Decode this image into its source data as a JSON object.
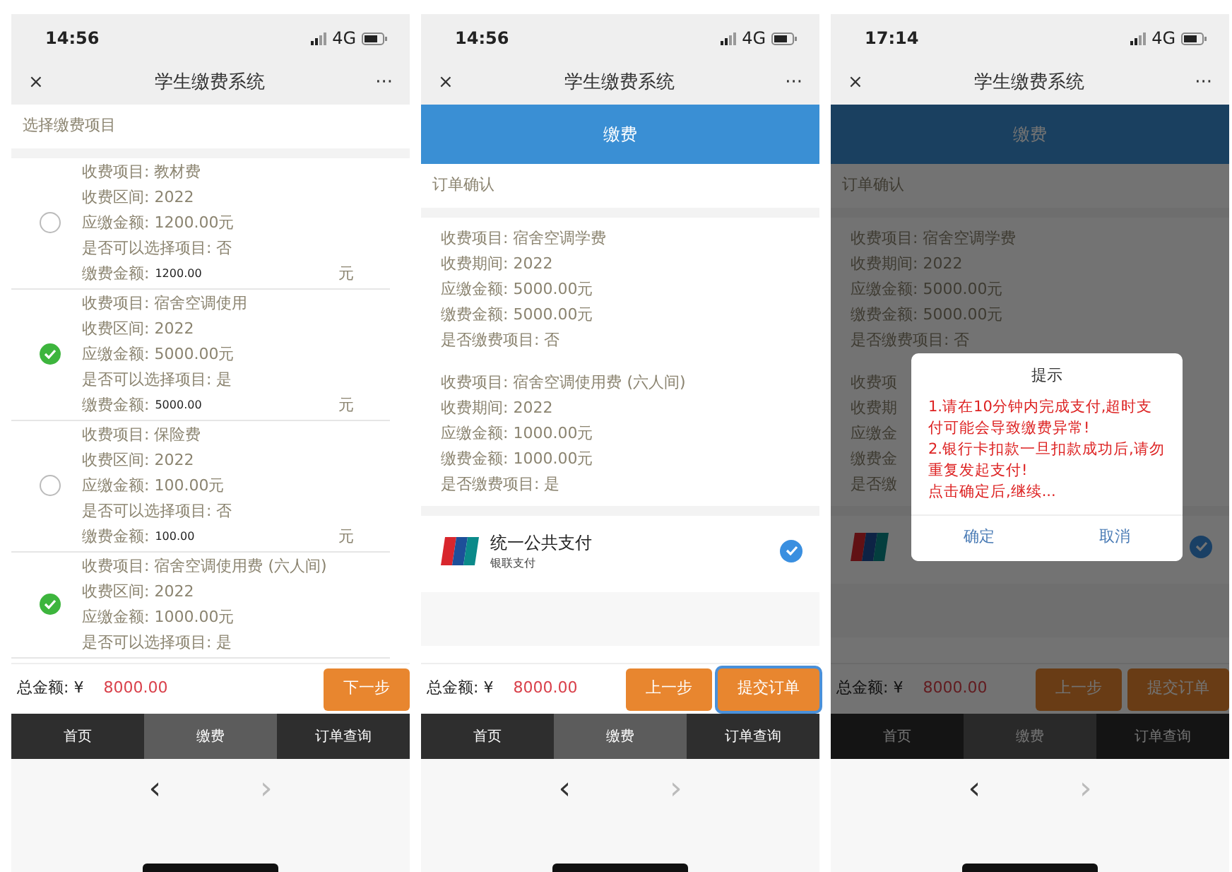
{
  "screens": [
    {
      "status": {
        "time": "14:56",
        "network": "4G"
      },
      "nav": {
        "close": "×",
        "title": "学生缴费系统",
        "more": "···"
      },
      "section_title": "选择缴费项目",
      "fee_items": [
        {
          "selected": false,
          "lines": [
            "收费项目: 教材费",
            "收费区间: 2022",
            "应缴金额: 1200.00元",
            "是否可以选择项目: 否"
          ],
          "amount": {
            "label": "缴费金额:",
            "value": "1200.00",
            "unit": "元"
          }
        },
        {
          "selected": true,
          "lines": [
            "收费项目: 宿舍空调使用",
            "收费区间: 2022",
            "应缴金额: 5000.00元",
            "是否可以选择项目: 是"
          ],
          "amount": {
            "label": "缴费金额:",
            "value": "5000.00",
            "unit": "元"
          }
        },
        {
          "selected": false,
          "lines": [
            "收费项目: 保险费",
            "收费区间: 2022",
            "应缴金额: 100.00元",
            "是否可以选择项目: 否"
          ],
          "amount": {
            "label": "缴费金额:",
            "value": "100.00",
            "unit": "元"
          }
        },
        {
          "selected": true,
          "lines": [
            "收费项目: 宿舍空调使用费 (六人间)",
            "收费区间: 2022",
            "应缴金额: 1000.00元",
            "是否可以选择项目: 是"
          ]
        }
      ],
      "total": {
        "label": "总金额: ¥",
        "value": "8000.00"
      },
      "buttons": [
        {
          "label": "下一步",
          "focused": false
        }
      ],
      "tabs": [
        {
          "label": "首页",
          "selected": false
        },
        {
          "label": "缴费",
          "selected": true
        },
        {
          "label": "订单查询",
          "selected": false
        }
      ],
      "browser": {
        "back": "‹",
        "forward": "›",
        "forward_disabled": true
      }
    },
    {
      "status": {
        "time": "14:56",
        "network": "4G"
      },
      "nav": {
        "close": "×",
        "title": "学生缴费系统",
        "more": "···"
      },
      "header": "缴费",
      "section_title": "订单确认",
      "order_items": [
        {
          "lines": [
            "收费项目: 宿舍空调学费",
            "收费期间: 2022",
            "应缴金额: 5000.00元",
            "缴费金额: 5000.00元",
            "是否缴费项目: 否"
          ]
        },
        {
          "lines": [
            "收费项目: 宿舍空调使用费 (六人间)",
            "收费期间: 2022",
            "应缴金额: 1000.00元",
            "缴费金额: 1000.00元",
            "是否缴费项目: 是"
          ]
        }
      ],
      "payment": {
        "title": "统一公共支付",
        "subtitle": "银联支付",
        "selected": true
      },
      "total": {
        "label": "总金额: ¥",
        "value": "8000.00"
      },
      "buttons": [
        {
          "label": "上一步",
          "focused": false
        },
        {
          "label": "提交订单",
          "focused": true
        }
      ],
      "tabs": [
        {
          "label": "首页",
          "selected": false
        },
        {
          "label": "缴费",
          "selected": true
        },
        {
          "label": "订单查询",
          "selected": false
        }
      ],
      "browser": {
        "back": "‹",
        "forward": "›",
        "forward_disabled": true
      }
    },
    {
      "status": {
        "time": "17:14",
        "network": "4G"
      },
      "nav": {
        "close": "×",
        "title": "学生缴费系统",
        "more": "···"
      },
      "header": "缴费",
      "section_title": "订单确认",
      "order_items": [
        {
          "lines": [
            "收费项目: 宿舍空调学费",
            "收费期间: 2022",
            "应缴金额: 5000.00元",
            "缴费金额: 5000.00元",
            "是否缴费项目: 否"
          ]
        },
        {
          "lines": [
            "收费项",
            "收费期",
            "应缴金",
            "缴费金",
            "是否缴"
          ]
        }
      ],
      "payment": {
        "selected": true
      },
      "total": {
        "label": "总金额: ¥",
        "value": "8000.00"
      },
      "buttons": [
        {
          "label": "上一步",
          "focused": false
        },
        {
          "label": "提交订单",
          "focused": false
        }
      ],
      "tabs": [
        {
          "label": "首页",
          "selected": false
        },
        {
          "label": "缴费",
          "selected": true
        },
        {
          "label": "订单查询",
          "selected": false
        }
      ],
      "browser": {
        "back": "‹",
        "forward": "›",
        "forward_disabled": true
      },
      "dialog": {
        "title": "提示",
        "messages": [
          "1.请在10分钟内完成支付,超时支付可能会导致缴费异常!",
          "2.银行卡扣款一旦扣款成功后,请勿重复发起支付!",
          "点击确定后,继续..."
        ],
        "buttons": [
          "确定",
          "取消"
        ]
      }
    }
  ]
}
